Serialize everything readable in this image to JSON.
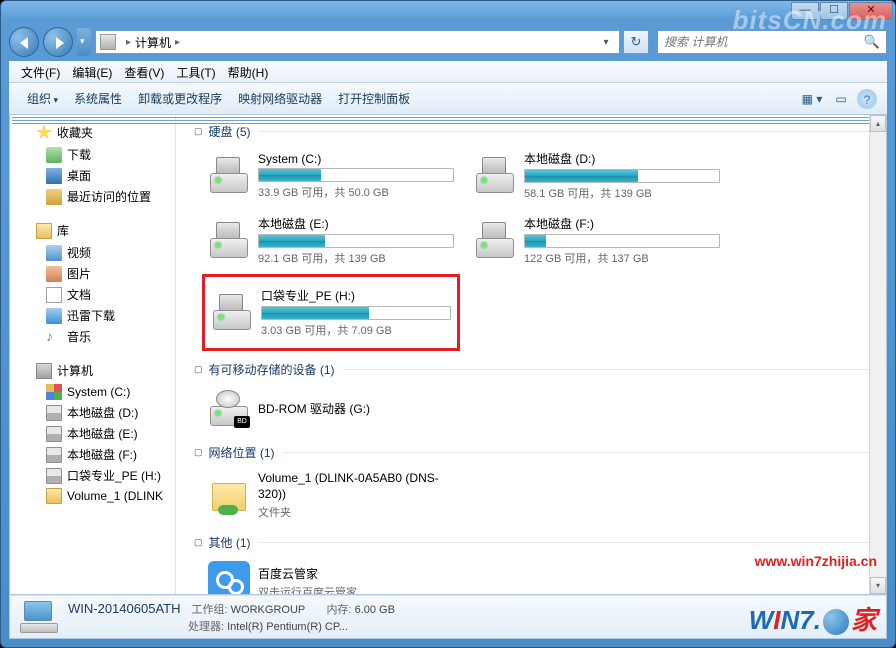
{
  "titlebar": {
    "min": "—",
    "max": "☐",
    "close": "✕"
  },
  "nav": {
    "location_label": "计算机",
    "refresh_glyph": "↻",
    "search_placeholder": "搜索 计算机",
    "search_glyph": "🔍"
  },
  "menu": {
    "file": "文件(F)",
    "edit": "编辑(E)",
    "view": "查看(V)",
    "tools": "工具(T)",
    "help": "帮助(H)"
  },
  "toolbar": {
    "organize": "组织",
    "props": "系统属性",
    "uninstall": "卸载或更改程序",
    "mapdrive": "映射网络驱动器",
    "control": "打开控制面板",
    "view_glyph": "▦",
    "preview_glyph": "▭",
    "help_glyph": "?"
  },
  "sidebar": {
    "favorites": {
      "label": "收藏夹",
      "items": [
        {
          "label": "下载"
        },
        {
          "label": "桌面"
        },
        {
          "label": "最近访问的位置"
        }
      ]
    },
    "libraries": {
      "label": "库",
      "items": [
        {
          "label": "视频"
        },
        {
          "label": "图片"
        },
        {
          "label": "文档"
        },
        {
          "label": "迅雷下载"
        },
        {
          "label": "音乐"
        }
      ]
    },
    "computer": {
      "label": "计算机",
      "items": [
        {
          "label": "System (C:)"
        },
        {
          "label": "本地磁盘 (D:)"
        },
        {
          "label": "本地磁盘 (E:)"
        },
        {
          "label": "本地磁盘 (F:)"
        },
        {
          "label": "口袋专业_PE (H:)"
        },
        {
          "label": "Volume_1 (DLINK"
        }
      ]
    }
  },
  "sections": {
    "hdd": "硬盘 (5)",
    "hdd_drives": [
      {
        "name": "System (C:)",
        "stats": "33.9 GB 可用，共 50.0 GB",
        "fill": 32
      },
      {
        "name": "本地磁盘 (D:)",
        "stats": "58.1 GB 可用，共 139 GB",
        "fill": 58
      },
      {
        "name": "本地磁盘 (E:)",
        "stats": "92.1 GB 可用，共 139 GB",
        "fill": 34
      },
      {
        "name": "本地磁盘 (F:)",
        "stats": "122 GB 可用，共 137 GB",
        "fill": 11
      },
      {
        "name": "口袋专业_PE (H:)",
        "stats": "3.03 GB 可用，共 7.09 GB",
        "fill": 57,
        "highlight": true
      }
    ],
    "removable": "有可移动存储的设备 (1)",
    "removable_items": [
      {
        "name": "BD-ROM 驱动器 (G:)"
      }
    ],
    "network": "网络位置 (1)",
    "network_items": [
      {
        "name": "Volume_1 (DLINK-0A5AB0 (DNS-320))",
        "sub": "文件夹"
      }
    ],
    "other": "其他 (1)",
    "other_items": [
      {
        "name": "百度云管家",
        "sub": "双击运行百度云管家"
      }
    ]
  },
  "status": {
    "name": "WIN-20140605ATH",
    "workgroup_lbl": "工作组:",
    "workgroup": "WORKGROUP",
    "cpu_lbl": "处理器:",
    "cpu": "Intel(R) Pentium(R) CP...",
    "mem_lbl": "内存:",
    "mem": "6.00 GB"
  },
  "watermarks": {
    "bitscn": "bitsCN.com",
    "url": "www.win7zhijia.cn"
  }
}
